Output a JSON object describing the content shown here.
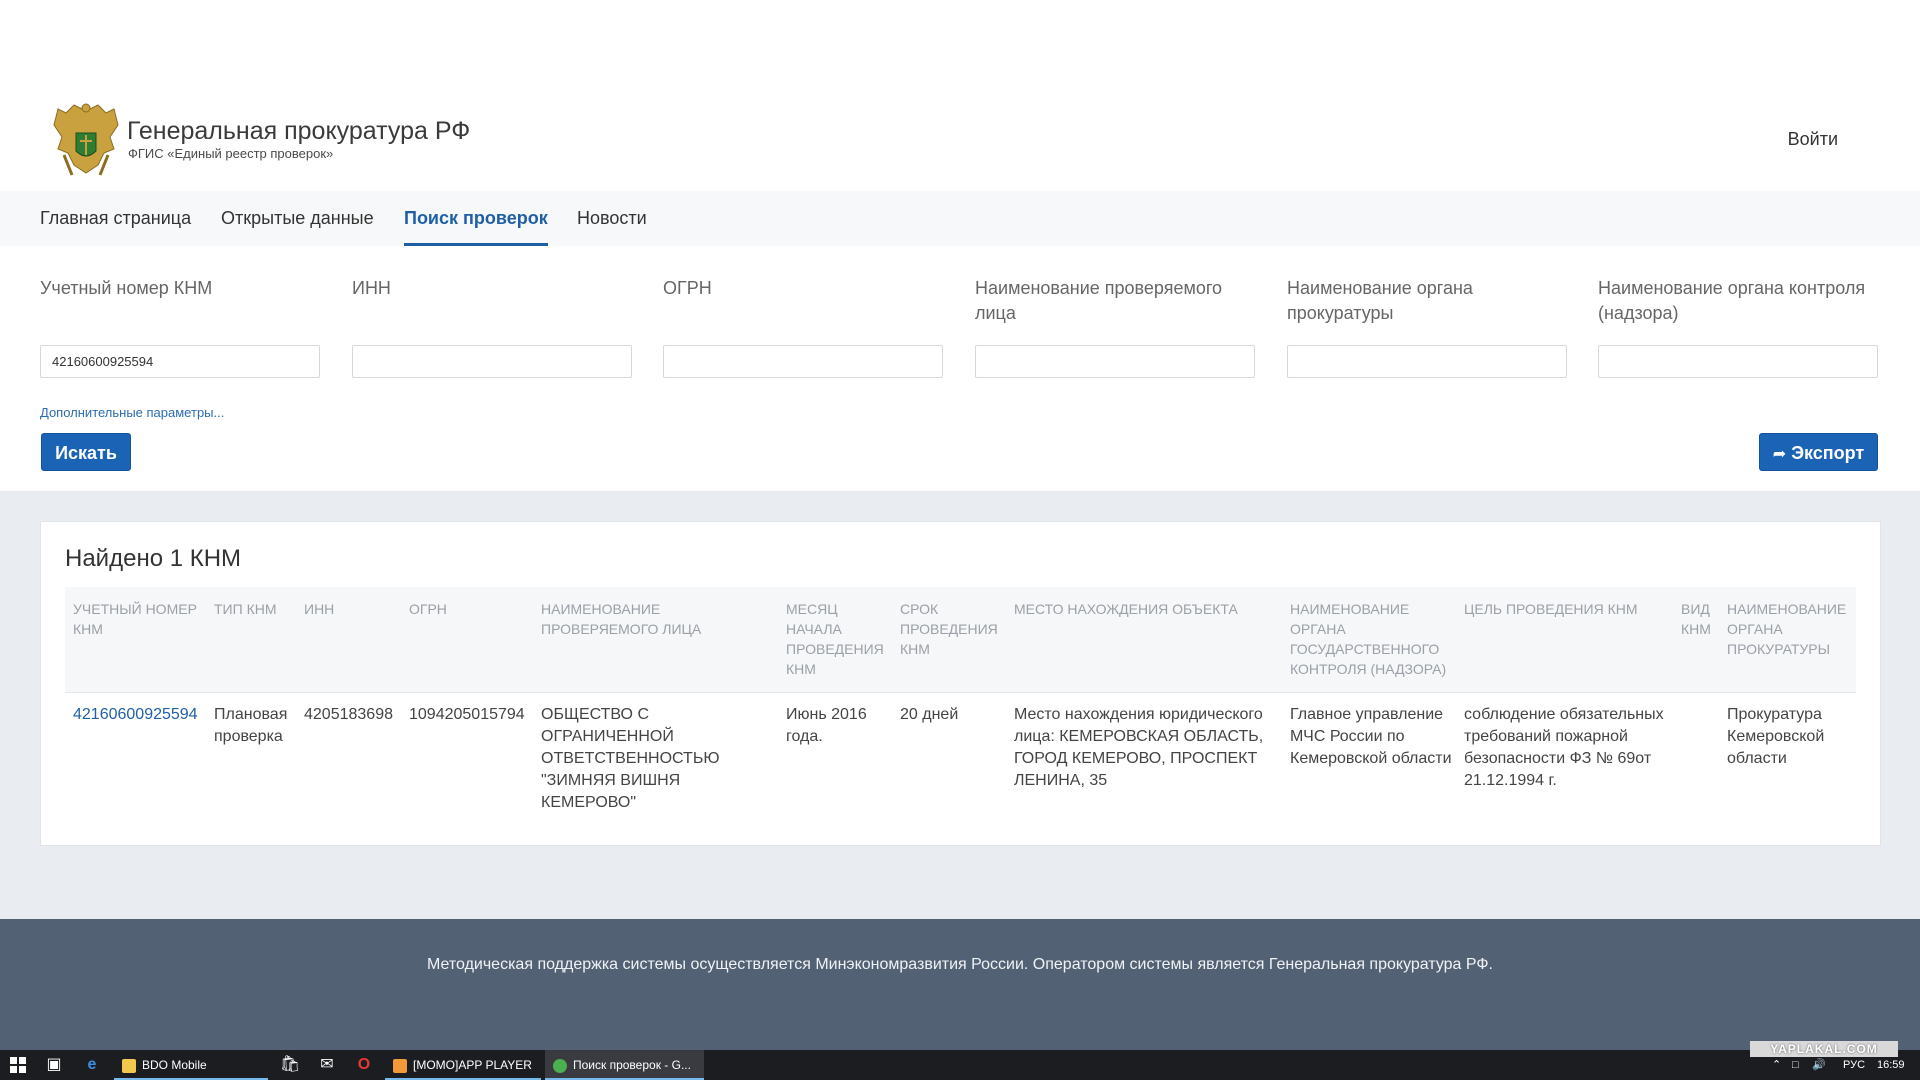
{
  "header": {
    "title": "Генеральная прокуратура РФ",
    "subtitle": "ФГИС «Единый реестр проверок»",
    "login": "Войти"
  },
  "nav": {
    "items": [
      {
        "label": "Главная страница"
      },
      {
        "label": "Открытые данные"
      },
      {
        "label": "Поиск проверок",
        "active": true
      },
      {
        "label": "Новости"
      }
    ]
  },
  "filters": {
    "fields": [
      {
        "label": "Учетный номер КНМ",
        "value": "42160600925594"
      },
      {
        "label": "ИНН",
        "value": ""
      },
      {
        "label": "ОГРН",
        "value": ""
      },
      {
        "label": "Наименование проверяемого лица",
        "value": ""
      },
      {
        "label": "Наименование органа прокуратуры",
        "value": ""
      },
      {
        "label": "Наименование органа контроля (надзора)",
        "value": ""
      }
    ],
    "extra_link": "Дополнительные параметры...",
    "search_button": "Искать",
    "export_button": "Экспорт"
  },
  "results": {
    "found": "Найдено 1 КНМ",
    "columns": [
      "Учетный номер КНМ",
      "Тип КНМ",
      "ИНН",
      "ОГРН",
      "Наименование проверяемого лица",
      "Месяц начала проведения КНМ",
      "Срок проведения КНМ",
      "Место нахождения объекта",
      "Наименование органа государственного контроля (надзора)",
      "Цель проведения КНМ",
      "Вид КНМ",
      "Наименование органа прокуратуры"
    ],
    "rows": [
      [
        "42160600925594",
        "Плановая проверка",
        "4205183698",
        "1094205015794",
        "ОБЩЕСТВО С ОГРАНИЧЕННОЙ ОТВЕТСТВЕННОСТЬЮ \"ЗИМНЯЯ ВИШНЯ КЕМЕРОВО\"",
        "Июнь 2016 года.",
        "20 дней",
        "Место нахождения юридического лица: КЕМЕРОВСКАЯ ОБЛАСТЬ, ГОРОД КЕМЕРОВО, ПРОСПЕКТ ЛЕНИНА, 35",
        "Главное управление МЧС России по Кемеровской области",
        "соблюдение обязательных требований пожарной безопасности ФЗ № 69от 21.12.1994 г.",
        "",
        "Прокуратура Кемеровской области"
      ]
    ]
  },
  "footer": {
    "text": "Методическая поддержка системы осуществляется Минэкономразвития России. Оператором системы является Генеральная прокуратура РФ."
  },
  "taskbar": {
    "tasks": [
      {
        "label": "BDO Mobile",
        "icon_color": "#f2c94c"
      },
      {
        "label": "[MOMO]APP PLAYER",
        "icon_color": "#f29a3a"
      },
      {
        "label": "Поиск проверок - G...",
        "icon_color": "#4caf50",
        "active": true
      }
    ],
    "lang": "РУС",
    "time": "16:59"
  },
  "watermark": "YAPLAKAL.COM",
  "colors": {
    "accent": "#1a63b5",
    "footer_bg": "#526274",
    "results_bg": "#e9ecf0"
  }
}
